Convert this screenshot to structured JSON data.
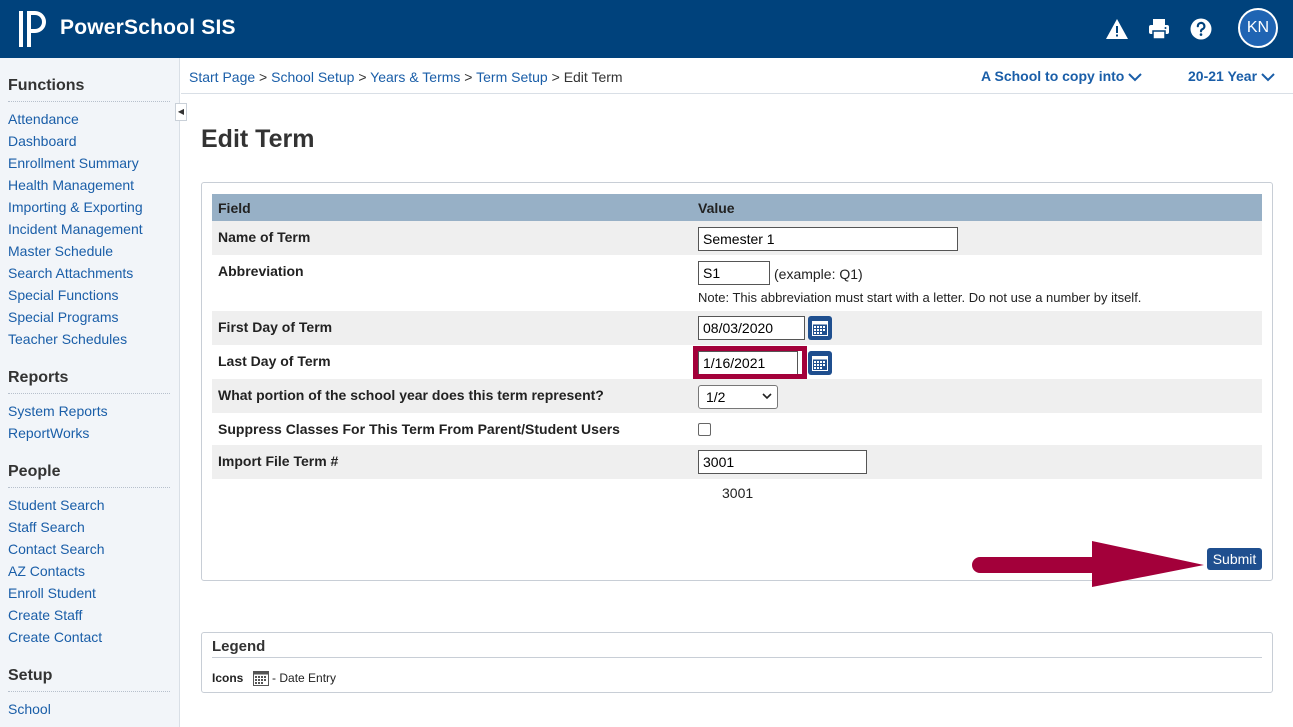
{
  "header": {
    "app_name": "PowerSchool SIS",
    "user_initials": "KN",
    "icons": [
      "warning-icon",
      "printer-icon",
      "help-icon"
    ]
  },
  "sidebar": {
    "sections": [
      {
        "title": "Functions",
        "items": [
          "Attendance",
          "Dashboard",
          "Enrollment Summary",
          "Health Management",
          "Importing & Exporting",
          "Incident Management",
          "Master Schedule",
          "Search Attachments",
          "Special Functions",
          "Special Programs",
          "Teacher Schedules"
        ]
      },
      {
        "title": "Reports",
        "items": [
          "System Reports",
          "ReportWorks"
        ]
      },
      {
        "title": "People",
        "items": [
          "Student Search",
          "Staff Search",
          "Contact Search",
          "AZ Contacts",
          "Enroll Student",
          "Create Staff",
          "Create Contact"
        ]
      },
      {
        "title": "Setup",
        "items": [
          "School"
        ]
      }
    ]
  },
  "breadcrumb": {
    "links": [
      "Start Page",
      "School Setup",
      "Years & Terms",
      "Term Setup"
    ],
    "separator": ">",
    "current": "Edit Term"
  },
  "selectors": {
    "school": "A School to copy into",
    "year": "20-21 Year"
  },
  "page": {
    "title": "Edit Term"
  },
  "form": {
    "col_field": "Field",
    "col_value": "Value",
    "name_label": "Name of Term",
    "name_value": "Semester 1",
    "abbr_label": "Abbreviation",
    "abbr_value": "S1",
    "abbr_example": "(example: Q1)",
    "abbr_note": "Note: This abbreviation must start with a letter. Do not use a number by itself.",
    "first_day_label": "First Day of Term",
    "first_day_value": "08/03/2020",
    "last_day_label": "Last Day of Term",
    "last_day_value": "1/16/2021",
    "portion_label": "What portion of the school year does this term represent?",
    "portion_value": "1/2",
    "suppress_label": "Suppress Classes For This Term From Parent/Student Users",
    "suppress_checked": false,
    "import_label": "Import File Term #",
    "import_value": "3001",
    "import_display": "3001",
    "submit_label": "Submit"
  },
  "annotation": {
    "highlight_color": "#a3003a"
  },
  "legend": {
    "title": "Legend",
    "icons_label": "Icons",
    "date_entry_label": "- Date Entry"
  },
  "colors": {
    "header_bg": "#00427c",
    "link": "#1a5ea8",
    "table_header": "#97b0c6",
    "button": "#1f4f8f"
  }
}
